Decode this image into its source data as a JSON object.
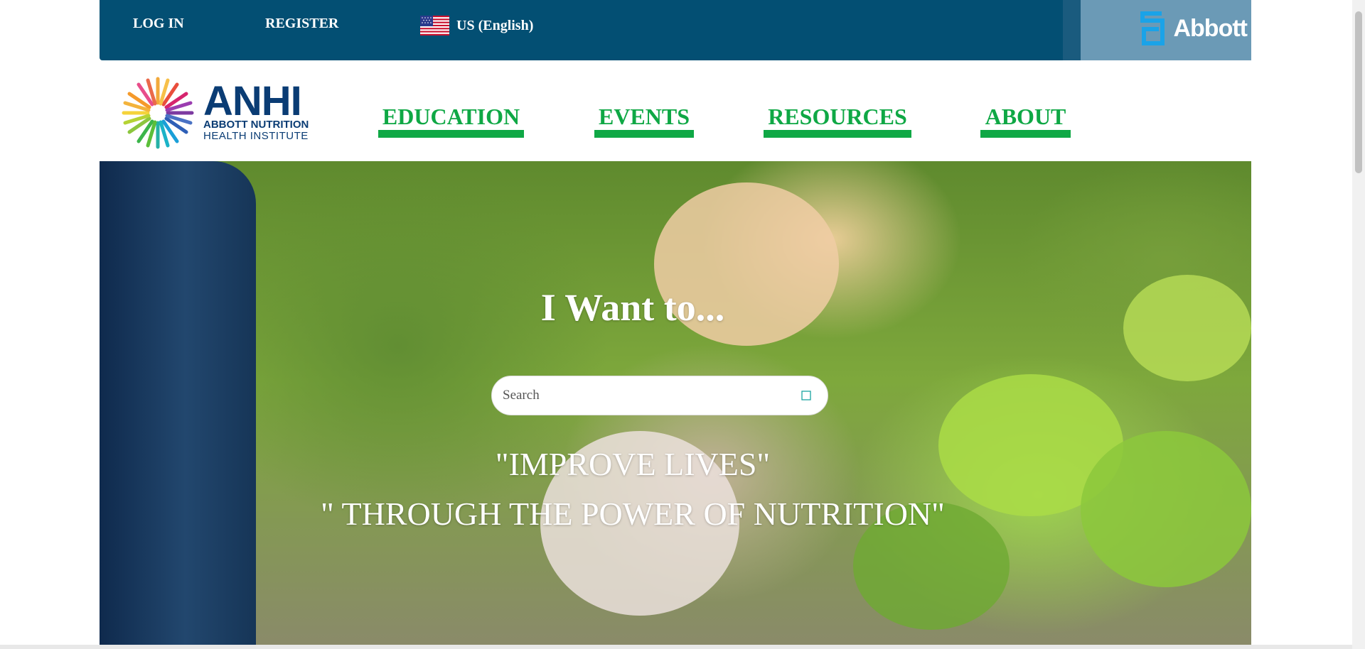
{
  "topbar": {
    "login_label": "LOG IN",
    "register_label": "REGISTER",
    "locale_label": "US (English)",
    "flag_icon": "us-flag-icon",
    "brand_logo_text": "Abbott",
    "colors": {
      "background": "#034f73",
      "brand_panel": "#6b9ab6"
    }
  },
  "header": {
    "logo_acronym": "ANHI",
    "logo_line1": "ABBOTT NUTRITION",
    "logo_line2": "HEALTH INSTITUTE",
    "nav": [
      {
        "label": "EDUCATION"
      },
      {
        "label": "EVENTS"
      },
      {
        "label": "RESOURCES"
      },
      {
        "label": "ABOUT"
      }
    ],
    "accent_color": "#0fa845"
  },
  "hero": {
    "title": "I Want to...",
    "search": {
      "placeholder": "Search",
      "value": "",
      "button_icon": "search-icon"
    },
    "tagline1": "\"IMPROVE LIVES\"",
    "tagline2": "\" THROUGH THE POWER OF NUTRITION\""
  }
}
